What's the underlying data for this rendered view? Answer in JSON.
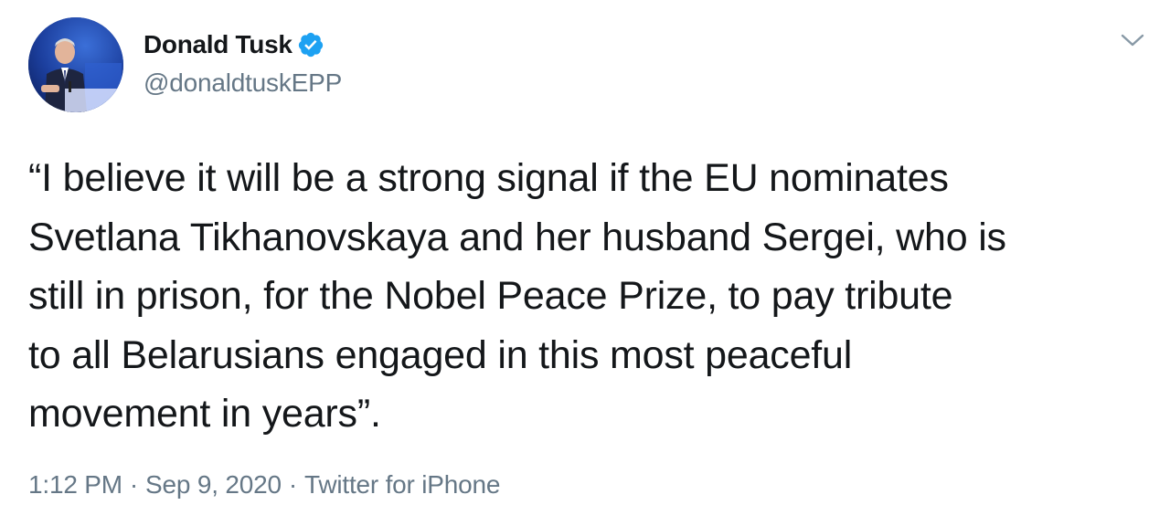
{
  "author": {
    "name": "Donald Tusk",
    "handle": "@donaldtuskEPP",
    "verified": true
  },
  "tweet": {
    "lines": [
      "“I believe it will be a strong signal if the EU nominates",
      "Svetlana Tikhanovskaya and her husband Sergei, who is",
      "still in prison, for the Nobel Peace Prize, to pay tribute",
      "to all Belarusians engaged in this most peaceful",
      "movement in years”."
    ]
  },
  "meta": {
    "time": "1:12 PM",
    "separator": "·",
    "date": "Sep 9, 2020",
    "source": "Twitter for iPhone"
  },
  "icons": {
    "verified": "verified-badge-icon",
    "menu": "chevron-down-icon"
  },
  "colors": {
    "text": "#14171a",
    "secondary": "#657786",
    "verified": "#1da1f2"
  }
}
